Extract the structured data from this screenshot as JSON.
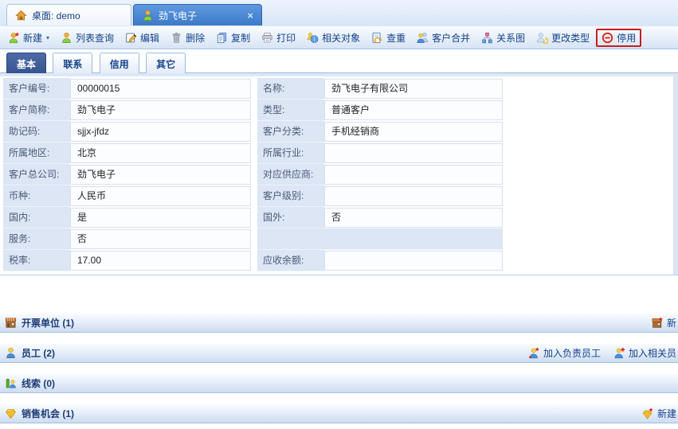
{
  "window_tabs": {
    "desktop_tab": "桌面: demo",
    "active_tab": "劲飞电子",
    "close_glyph": "×"
  },
  "toolbar": {
    "dropdown_glyph": "▾",
    "new": "新建",
    "list_query": "列表查询",
    "edit": "编辑",
    "delete": "删除",
    "copy": "复制",
    "print": "打印",
    "related_objects": "相关对象",
    "check_duplicate": "查重",
    "merge_customers": "客户合并",
    "relationship_graph": "关系图",
    "change_type": "更改类型",
    "disable": "停用"
  },
  "detail_tabs": {
    "basic": "基本",
    "contact": "联系",
    "credit": "信用",
    "other": "其它"
  },
  "form": {
    "rows": [
      {
        "ll": "客户编号:",
        "lv": "00000015",
        "rl": "名称:",
        "rv": "劲飞电子有限公司"
      },
      {
        "ll": "客户简称:",
        "lv": "劲飞电子",
        "rl": "类型:",
        "rv": "普通客户"
      },
      {
        "ll": "助记码:",
        "lv": "sjjx-jfdz",
        "rl": "客户分类:",
        "rv": "手机经销商"
      },
      {
        "ll": "所属地区:",
        "lv": "北京",
        "rl": "所属行业:",
        "rv": ""
      },
      {
        "ll": "客户总公司:",
        "lv": "劲飞电子",
        "rl": "对应供应商:",
        "rv": ""
      },
      {
        "ll": "币种:",
        "lv": "人民币",
        "rl": "客户级别:",
        "rv": ""
      },
      {
        "ll": "国内:",
        "lv": "是",
        "rl": "国外:",
        "rv": "否"
      },
      {
        "ll": "服务:",
        "lv": "否",
        "rl": "",
        "rv": ""
      },
      {
        "ll": "税率:",
        "lv": "17.00",
        "rl": "应收余额:",
        "rv": ""
      }
    ]
  },
  "sections": [
    {
      "title": "开票单位 (1)",
      "actions": [
        "新"
      ]
    },
    {
      "title": "员工 (2)",
      "actions": [
        "加入负责员工",
        "加入相关员"
      ]
    },
    {
      "title": "线索 (0)",
      "actions": []
    },
    {
      "title": "销售机会 (1)",
      "actions": [
        "新建"
      ]
    }
  ],
  "colors": {
    "active_tab": "#3c79c8",
    "subtab_active": "#35528d",
    "highlight_border": "#c41f1f",
    "label_bg": "#dce6f4",
    "section_title_text": "#1e3c78",
    "toolbar_text": "#15428b"
  }
}
